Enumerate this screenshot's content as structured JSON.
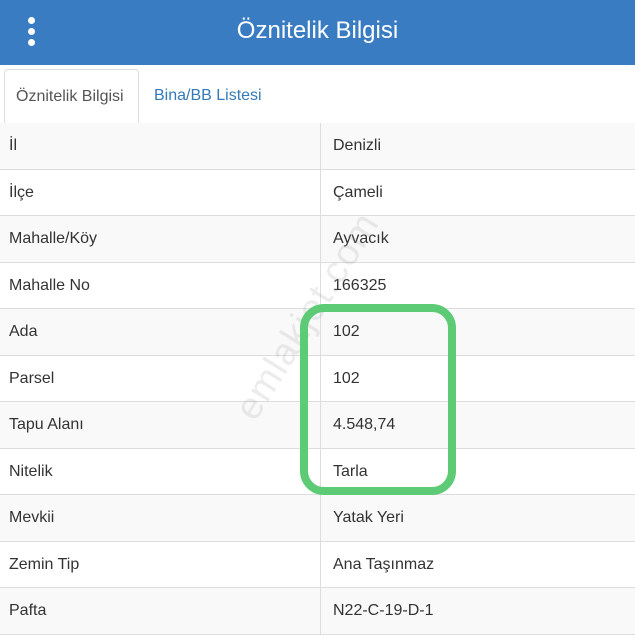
{
  "header": {
    "title": "Öznitelik Bilgisi",
    "menu_icon": "vertical-dots-icon",
    "background_color": "#3a7cc2"
  },
  "tabs": [
    {
      "label": "Öznitelik Bilgisi",
      "active": true
    },
    {
      "label": "Bina/BB Listesi",
      "active": false
    }
  ],
  "rows": [
    {
      "label": "İl",
      "value": "Denizli"
    },
    {
      "label": "İlçe",
      "value": "Çameli"
    },
    {
      "label": "Mahalle/Köy",
      "value": "Ayvacık"
    },
    {
      "label": "Mahalle No",
      "value": "166325"
    },
    {
      "label": "Ada",
      "value": "102"
    },
    {
      "label": "Parsel",
      "value": "102"
    },
    {
      "label": "Tapu Alanı",
      "value": "4.548,74"
    },
    {
      "label": "Nitelik",
      "value": "Tarla"
    },
    {
      "label": "Mevkii",
      "value": "Yatak Yeri"
    },
    {
      "label": "Zemin Tip",
      "value": "Ana Taşınmaz"
    },
    {
      "label": "Pafta",
      "value": "N22-C-19-D-1"
    }
  ],
  "watermark": "emlakjet.com",
  "highlight_color": "#5dcb76"
}
